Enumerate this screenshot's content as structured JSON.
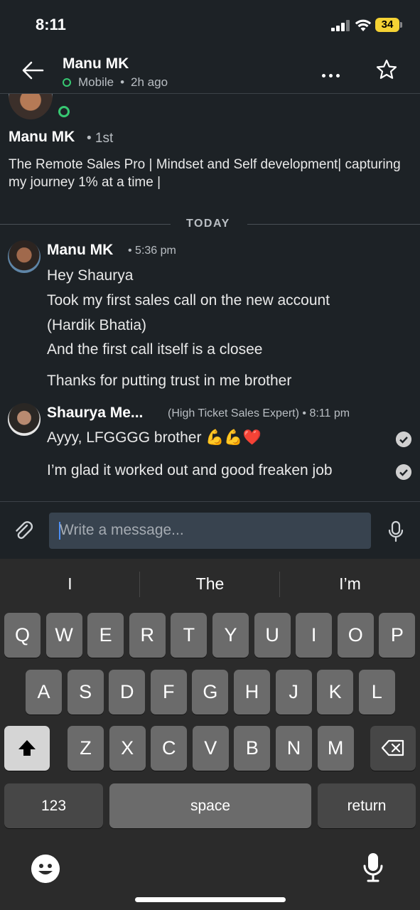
{
  "status_bar": {
    "time": "8:11",
    "battery": "34"
  },
  "header": {
    "name": "Manu MK",
    "status_device": "Mobile",
    "status_separator": "•",
    "status_time": "2h ago"
  },
  "profile": {
    "name": "Manu MK",
    "degree": "• 1st",
    "headline": "The Remote Sales Pro | Mindset and Self development| capturing my journey 1% at a time |"
  },
  "divider": {
    "label": "TODAY"
  },
  "messages": [
    {
      "sender": "Manu MK",
      "meta": "•  5:36 pm",
      "lines": [
        "Hey Shaurya",
        "Took my first sales call on the new account",
        "(Hardik Bhatia)",
        "And the first call itself is a closee",
        "Thanks for putting trust in me brother"
      ]
    },
    {
      "sender": "Shaurya Me...",
      "meta": "(High Ticket Sales Expert)  •  8:11 pm",
      "lines": [
        "Ayyy, LFGGGG brother 💪💪❤️",
        "I’m glad it worked out and good freaken job"
      ]
    }
  ],
  "composer": {
    "placeholder": "Write a message..."
  },
  "keyboard": {
    "suggestions": [
      "I",
      "The",
      "I’m"
    ],
    "row1": [
      "Q",
      "W",
      "E",
      "R",
      "T",
      "Y",
      "U",
      "I",
      "O",
      "P"
    ],
    "row2": [
      "A",
      "S",
      "D",
      "F",
      "G",
      "H",
      "J",
      "K",
      "L"
    ],
    "row3": [
      "Z",
      "X",
      "C",
      "V",
      "B",
      "N",
      "M"
    ],
    "numbers_label": "123",
    "space_label": "space",
    "return_label": "return"
  },
  "colors": {
    "background": "#1d2226",
    "online_green": "#37c872",
    "input_bg": "#38434f",
    "battery": "#f4d234"
  }
}
